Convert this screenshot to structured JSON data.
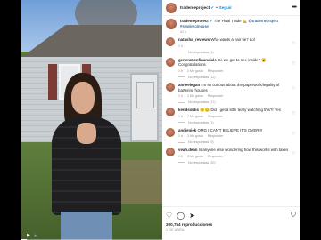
{
  "header": {
    "username": "trademeproject",
    "verified_icon": "verified-badge-icon",
    "follow_label": "Seguir",
    "more_icon": "more-horizontal-icon"
  },
  "caption": {
    "username": "trademeproject",
    "text": "The Final Trade",
    "mention": "@trademeproject",
    "hashtag": "#singlehomeuse",
    "time": "41 h"
  },
  "comments": [
    {
      "username": "natasha_reviews",
      "text": "Who wants a hair tie? Lol",
      "time": "1 h",
      "likes": "",
      "reply": "",
      "replies": "No respuestas (1)"
    },
    {
      "username": "generationfinancials",
      "text": "Do we get to see inside? 😮 Congratulations",
      "time": "1 h",
      "likes": "2 Me gusta",
      "reply": "Responder",
      "replies": "No respuestas (12)"
    },
    {
      "username": "anneelegan",
      "text": "I'm so curious about the paperwork/legality of bartering houses",
      "time": "1 h",
      "likes": "1 Me gusta",
      "reply": "Responder",
      "replies": "No respuestas (17)"
    },
    {
      "username": "kendsoldis",
      "text": "😊😊 Did I get a little teary watching this?! Yes",
      "time": "1 h",
      "likes": "7 Me gusta",
      "reply": "Responder",
      "replies": "No respuestas (1)"
    },
    {
      "username": "andieniek",
      "text": "OMG I CAN'T BELIEVE IT'S OVER!!!",
      "time": "1 h",
      "likes": "3 Me gusta",
      "reply": "Responder",
      "replies": "No respuestas (5)"
    },
    {
      "username": "veah.dean",
      "text": "Is anyone else wondering how this works with taxes",
      "time": "1 h",
      "likes": "3 Me gusta",
      "reply": "Responder",
      "replies": "No respuestas (20)"
    }
  ],
  "footer": {
    "views": "200,754 reproducciones",
    "date": "1 DE ABRIL"
  },
  "video": {
    "progress": 0.04,
    "play_icon": "play-icon",
    "volume_icon": "volume-icon"
  },
  "icons": {
    "like": "heart-icon",
    "comment": "comment-icon",
    "share": "share-icon",
    "save": "bookmark-icon",
    "comment_like": "heart-outline-icon"
  },
  "colors": {
    "accent": "#0095f6",
    "muted": "#8e8e8e",
    "text": "#262626"
  }
}
